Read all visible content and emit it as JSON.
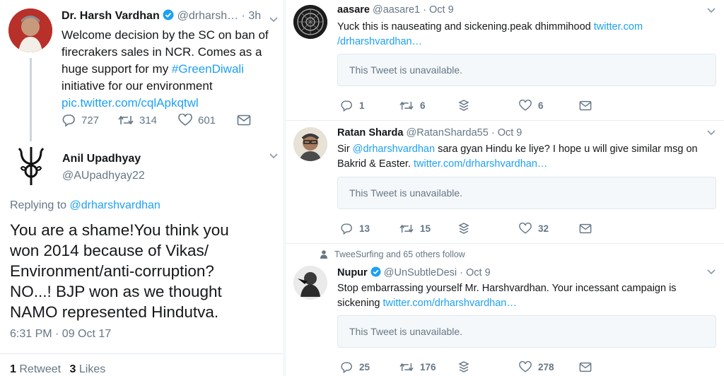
{
  "left": {
    "tweet1": {
      "name": "Dr. Harsh Vardhan",
      "handle": "@drharsh…",
      "time": "· 3h",
      "text_line1": "Welcome decision by the SC on ban of",
      "text_line2": "firecrakers sales in NCR. Comes as a",
      "text_line3_prefix": "huge support for my ",
      "hashtag": "#GreenDiwali",
      "text_line4": "initiative for our environment",
      "link": "pic.twitter.com/cqlApkqtwl",
      "replies": "727",
      "retweets": "314",
      "likes": "601"
    },
    "tweet2": {
      "name": "Anil Upadhyay",
      "handle": "@AUpadhyay22",
      "replying_prefix": "Replying to ",
      "replying_to": "@drharshvardhan",
      "text_lines": [
        "You are a shame!You think you",
        "won 2014 because of Vikas/",
        "Environment/anti-corruption?",
        "NO...! BJP won as we thought",
        "NAMO represented Hindutva."
      ],
      "timestamp": "6:31 PM · 09 Oct 17",
      "retweet_count": "1",
      "retweet_label": "Retweet",
      "like_count": "3",
      "like_label": "Likes"
    }
  },
  "right": {
    "tweets": [
      {
        "name": "aasare",
        "handle": "@aasare1",
        "date": "· Oct 9",
        "line1": "Yuck this is nauseating and sickening.peak dhimmihood ",
        "line1_link": "twitter.com",
        "line2_link": "/drharshvardhan…",
        "unavailable": "This Tweet is unavailable.",
        "replies": "1",
        "retweets": "6",
        "likes": "6"
      },
      {
        "name": "Ratan Sharda",
        "handle": "@RatanSharda55",
        "date": "· Oct 9",
        "line1_prefix": "Sir ",
        "mention": "@drharshvardhan",
        "line1_suffix": " sara gyan Hindu ke liye? I hope u will give similar msg on",
        "line2_text": "Bakrid & Easter. ",
        "line2_link": "twitter.com/drharshvardhan…",
        "unavailable": "This Tweet is unavailable.",
        "replies": "13",
        "retweets": "15",
        "likes": "32"
      },
      {
        "social_context": "TweeSurfing and 65 others follow",
        "name": "Nupur",
        "handle": "@UnSubtleDesi",
        "date": "· Oct 9",
        "line1": "Stop embarrassing yourself Mr. Harshvardhan. Your incessant campaign is",
        "line2_text": "sickening ",
        "line2_link": "twitter.com/drharshvardhan…",
        "unavailable": "This Tweet is unavailable.",
        "replies": "25",
        "retweets": "176",
        "likes": "278"
      }
    ]
  }
}
